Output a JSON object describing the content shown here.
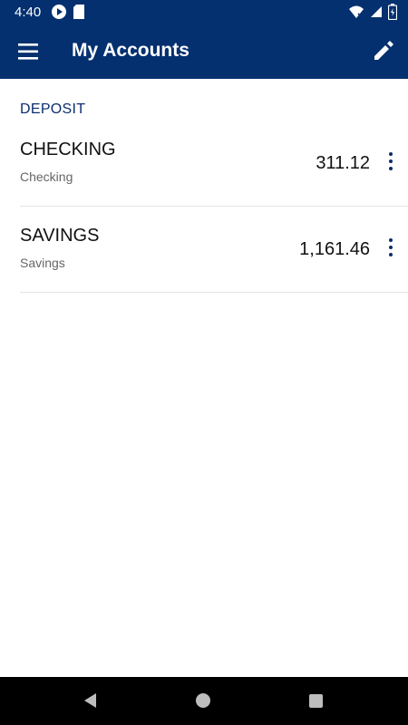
{
  "status_bar": {
    "time": "4:40",
    "icons": [
      "sync-icon",
      "sd-card-icon",
      "wifi-icon",
      "signal-icon",
      "battery-charging-icon"
    ]
  },
  "app_bar": {
    "title": "My Accounts",
    "menu_icon": "hamburger-menu-icon",
    "edit_icon": "pencil-edit-icon",
    "background_color": "#04306f"
  },
  "section": {
    "label": "DEPOSIT"
  },
  "accounts": [
    {
      "name": "CHECKING",
      "type": "Checking",
      "balance": "311.12"
    },
    {
      "name": "SAVINGS",
      "type": "Savings",
      "balance": "1,161.46"
    }
  ],
  "accent_color": "#0a2d6e",
  "nav_bar": {
    "icons": [
      "back-icon",
      "home-icon",
      "recents-icon"
    ]
  }
}
